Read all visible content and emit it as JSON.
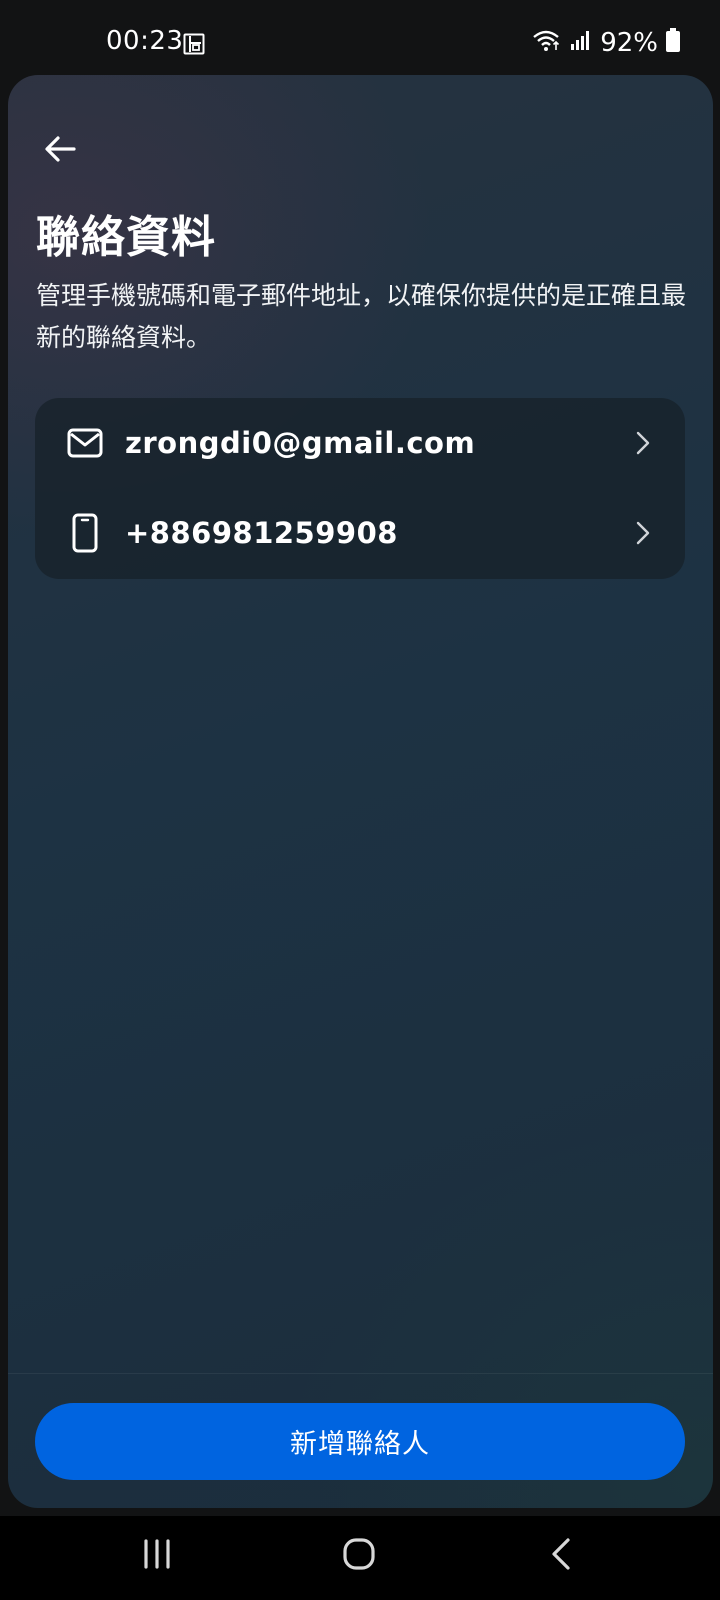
{
  "status_bar": {
    "time": "00:23",
    "battery": "92%",
    "icons": [
      "card-icon",
      "wifi-icon",
      "signal-icon",
      "battery-icon"
    ]
  },
  "header": {
    "back_icon": "arrow-left-icon",
    "title": "聯絡資料",
    "description": "管理手機號碼和電子郵件地址，以確保你提供的是正確且最新的聯絡資料。"
  },
  "contacts": [
    {
      "type": "email",
      "icon": "mail-icon",
      "value": "zrongdi0@gmail.com"
    },
    {
      "type": "phone",
      "icon": "phone-icon",
      "value": "+886981259908"
    }
  ],
  "actions": {
    "add_contact_label": "新增聯絡人"
  },
  "nav_bar": {
    "icons": [
      "recent-apps-icon",
      "home-icon",
      "back-icon"
    ]
  },
  "colors": {
    "accent": "#0064e0",
    "sheet_bg": "#1d3243",
    "card_bg": "#162028"
  }
}
